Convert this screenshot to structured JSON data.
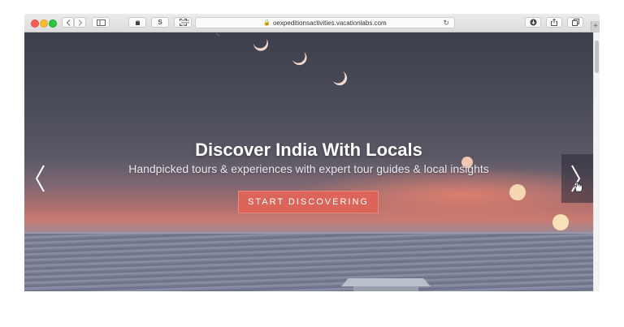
{
  "browser": {
    "url": "oexpeditionsactivities.vacationlabs.com",
    "buttons": {
      "back_icon": "chevron-left-icon",
      "forward_icon": "chevron-right-icon",
      "sidebar_icon": "sidebar-icon",
      "ext1_icon": "hand-icon",
      "ext2_label": "S",
      "ext3_icon": "expand-icon",
      "reader_icon": "reader-icon",
      "download_icon": "download-icon",
      "share_icon": "share-icon",
      "tabs_icon": "tabs-icon"
    },
    "tab_plus": "+"
  },
  "hero": {
    "title": "Discover India With Locals",
    "subtitle": "Handpicked tours & experiences with expert tour guides & local insights",
    "cta_label": "START DISCOVERING",
    "slides": 4,
    "active_slide": 1
  },
  "colors": {
    "accent": "#dd6458",
    "sky_top": "#3d3f4c",
    "sunset": "#c97b72"
  }
}
